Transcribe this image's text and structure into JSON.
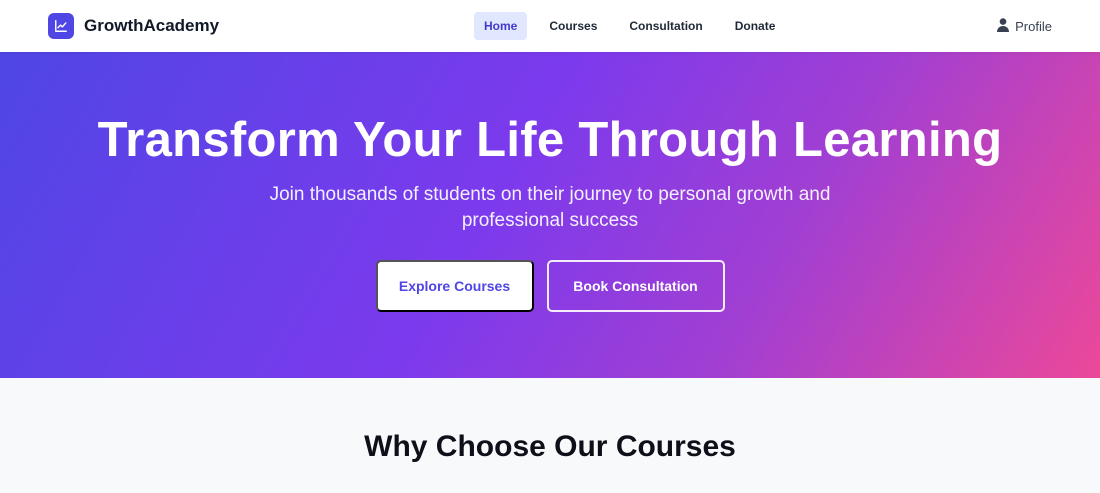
{
  "brand": {
    "name": "GrowthAcademy",
    "logo_icon": "chart-line-icon",
    "logo_color": "#4f46e5"
  },
  "nav": {
    "items": [
      {
        "label": "Home",
        "active": true
      },
      {
        "label": "Courses",
        "active": false
      },
      {
        "label": "Consultation",
        "active": false
      },
      {
        "label": "Donate",
        "active": false
      }
    ]
  },
  "profile": {
    "label": "Profile",
    "icon": "user-icon"
  },
  "hero": {
    "title": "Transform Your Life Through Learning",
    "subtitle": "Join thousands of students on their journey to personal growth and professional success",
    "primary_button": "Explore Courses",
    "secondary_button": "Book Consultation",
    "gradient": [
      "#4f46e5",
      "#7c3aed",
      "#ec4899"
    ]
  },
  "why": {
    "title": "Why Choose Our Courses"
  }
}
